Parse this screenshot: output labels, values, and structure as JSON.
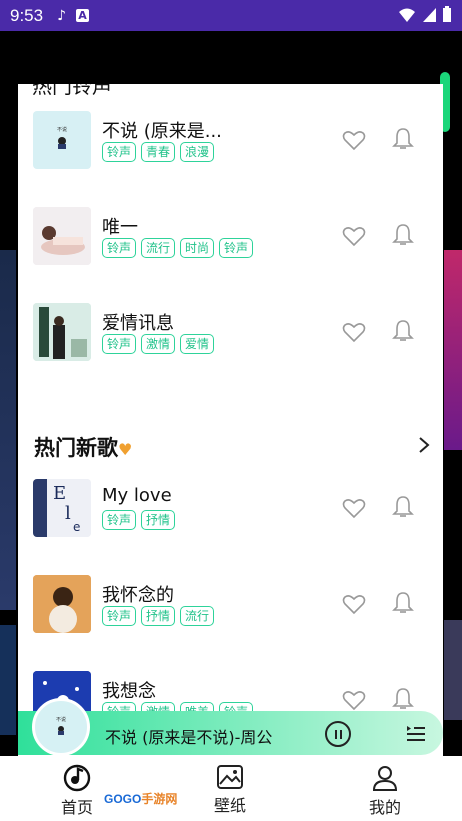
{
  "status_bar": {
    "time": "9:53"
  },
  "peek_title": "热门铃声",
  "songs_top": [
    {
      "title": "不说 (原来是...",
      "tags": [
        "铃声",
        "青春",
        "浪漫"
      ]
    },
    {
      "title": "唯一",
      "tags": [
        "铃声",
        "流行",
        "时尚",
        "铃声"
      ]
    },
    {
      "title": "爱情讯息",
      "tags": [
        "铃声",
        "激情",
        "爱情"
      ]
    }
  ],
  "section": {
    "title": "热门新歌"
  },
  "songs_new": [
    {
      "title": "My love",
      "tags": [
        "铃声",
        "抒情"
      ]
    },
    {
      "title": "我怀念的",
      "tags": [
        "铃声",
        "抒情",
        "流行"
      ]
    },
    {
      "title": "我想念",
      "tags": [
        "铃声",
        "激情",
        "唯美",
        "铃声"
      ]
    }
  ],
  "player": {
    "title": "不说 (原来是不说)-周公"
  },
  "tabbar": {
    "home": "首页",
    "wallpaper": "壁纸",
    "mine": "我的"
  },
  "watermark": {
    "brand": "GOGO",
    "suffix": "手游网"
  },
  "colors": {
    "accent": "#2ed39a",
    "status_bar": "#4a2aa8"
  }
}
